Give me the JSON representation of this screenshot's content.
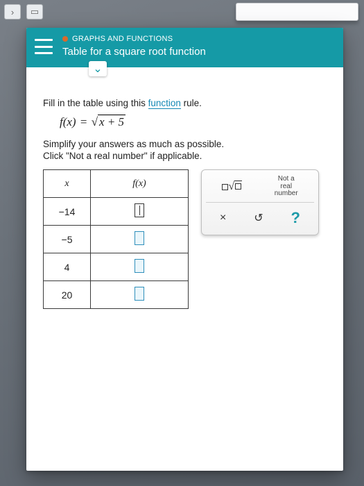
{
  "toolbar": {
    "back_glyph": "›",
    "reader_glyph": "▭"
  },
  "banner": {
    "breadcrumb": "GRAPHS AND FUNCTIONS",
    "title": "Table for a square root function",
    "expand_glyph": "⌄"
  },
  "instructions": {
    "line1_pre": "Fill in the table using this ",
    "line1_link": "function",
    "line1_post": " rule.",
    "formula_lhs": "f(x)",
    "formula_eq": "=",
    "formula_rad": "x + 5",
    "line2": "Simplify your answers as much as possible.",
    "line3": "Click \"Not a real number\" if applicable."
  },
  "table": {
    "head_x": "x",
    "head_fx": "f(x)",
    "rows": [
      {
        "x": "−14",
        "active": true
      },
      {
        "x": "−5",
        "active": false
      },
      {
        "x": "4",
        "active": false
      },
      {
        "x": "20",
        "active": false
      }
    ]
  },
  "panel": {
    "not_real": "Not a\nreal\nnumber",
    "times": "×",
    "reset": "↺",
    "help": "?"
  }
}
